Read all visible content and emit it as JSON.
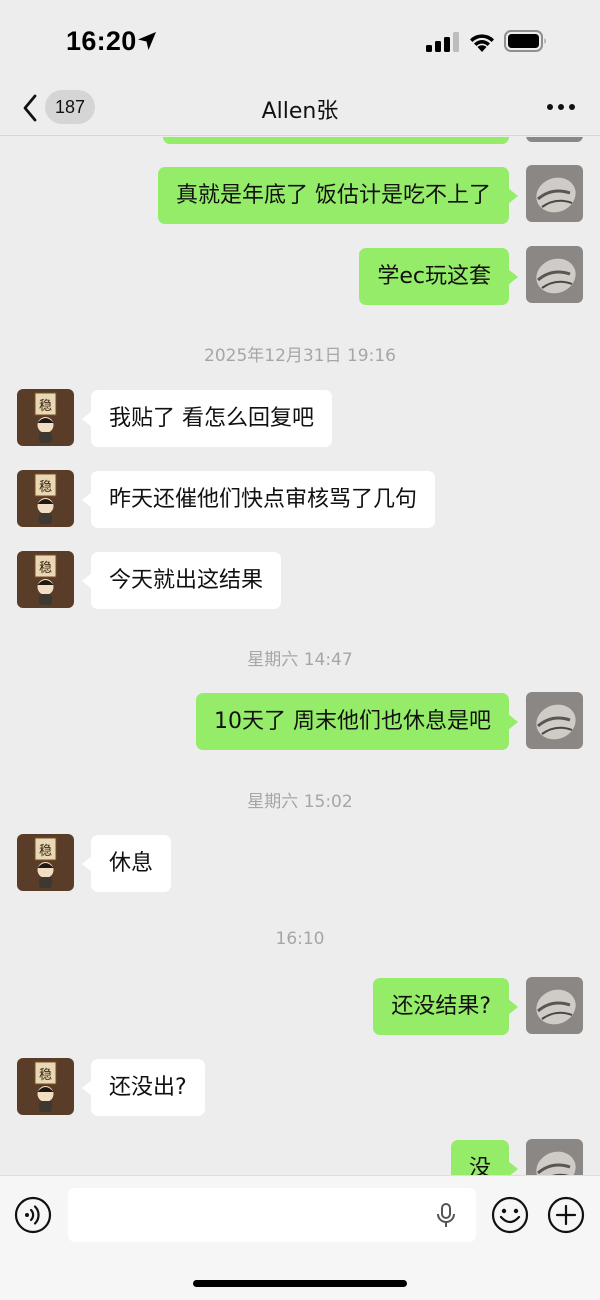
{
  "status_bar": {
    "time": "16:20"
  },
  "header": {
    "back_label": "",
    "unread_count": "187",
    "title": "Allen张"
  },
  "messages": [
    {
      "text": "真就是年底了 饭估计是吃不上了",
      "direction": "out"
    },
    {
      "text": "学ec玩这套",
      "direction": "out"
    },
    {
      "text": "我贴了 看怎么回复吧",
      "direction": "in"
    },
    {
      "text": "昨天还催他们快点审核骂了几句",
      "direction": "in"
    },
    {
      "text": "今天就出这结果",
      "direction": "in"
    },
    {
      "text": "10天了 周末他们也休息是吧",
      "direction": "out"
    },
    {
      "text": "休息",
      "direction": "in"
    },
    {
      "text": "还没结果?",
      "direction": "out"
    },
    {
      "text": "还没出?",
      "direction": "in"
    },
    {
      "text": "没",
      "direction": "out"
    }
  ],
  "timestamps": [
    "2025年12月31日 19:16",
    "星期六 14:47",
    "星期六 15:02",
    "16:10"
  ],
  "input": {
    "value": "",
    "placeholder": ""
  },
  "icons": {
    "voice": "voice-mode-icon",
    "mic": "microphone-icon",
    "emoji": "emoji-icon",
    "plus": "plus-icon",
    "back": "chevron-left-icon",
    "more": "more-dots-icon"
  },
  "colors": {
    "background": "#ededed",
    "outgoing_bubble": "#95ec69",
    "incoming_bubble": "#ffffff",
    "timestamp_text": "#a6a6a6"
  },
  "contact_avatar_glyph": "稳"
}
